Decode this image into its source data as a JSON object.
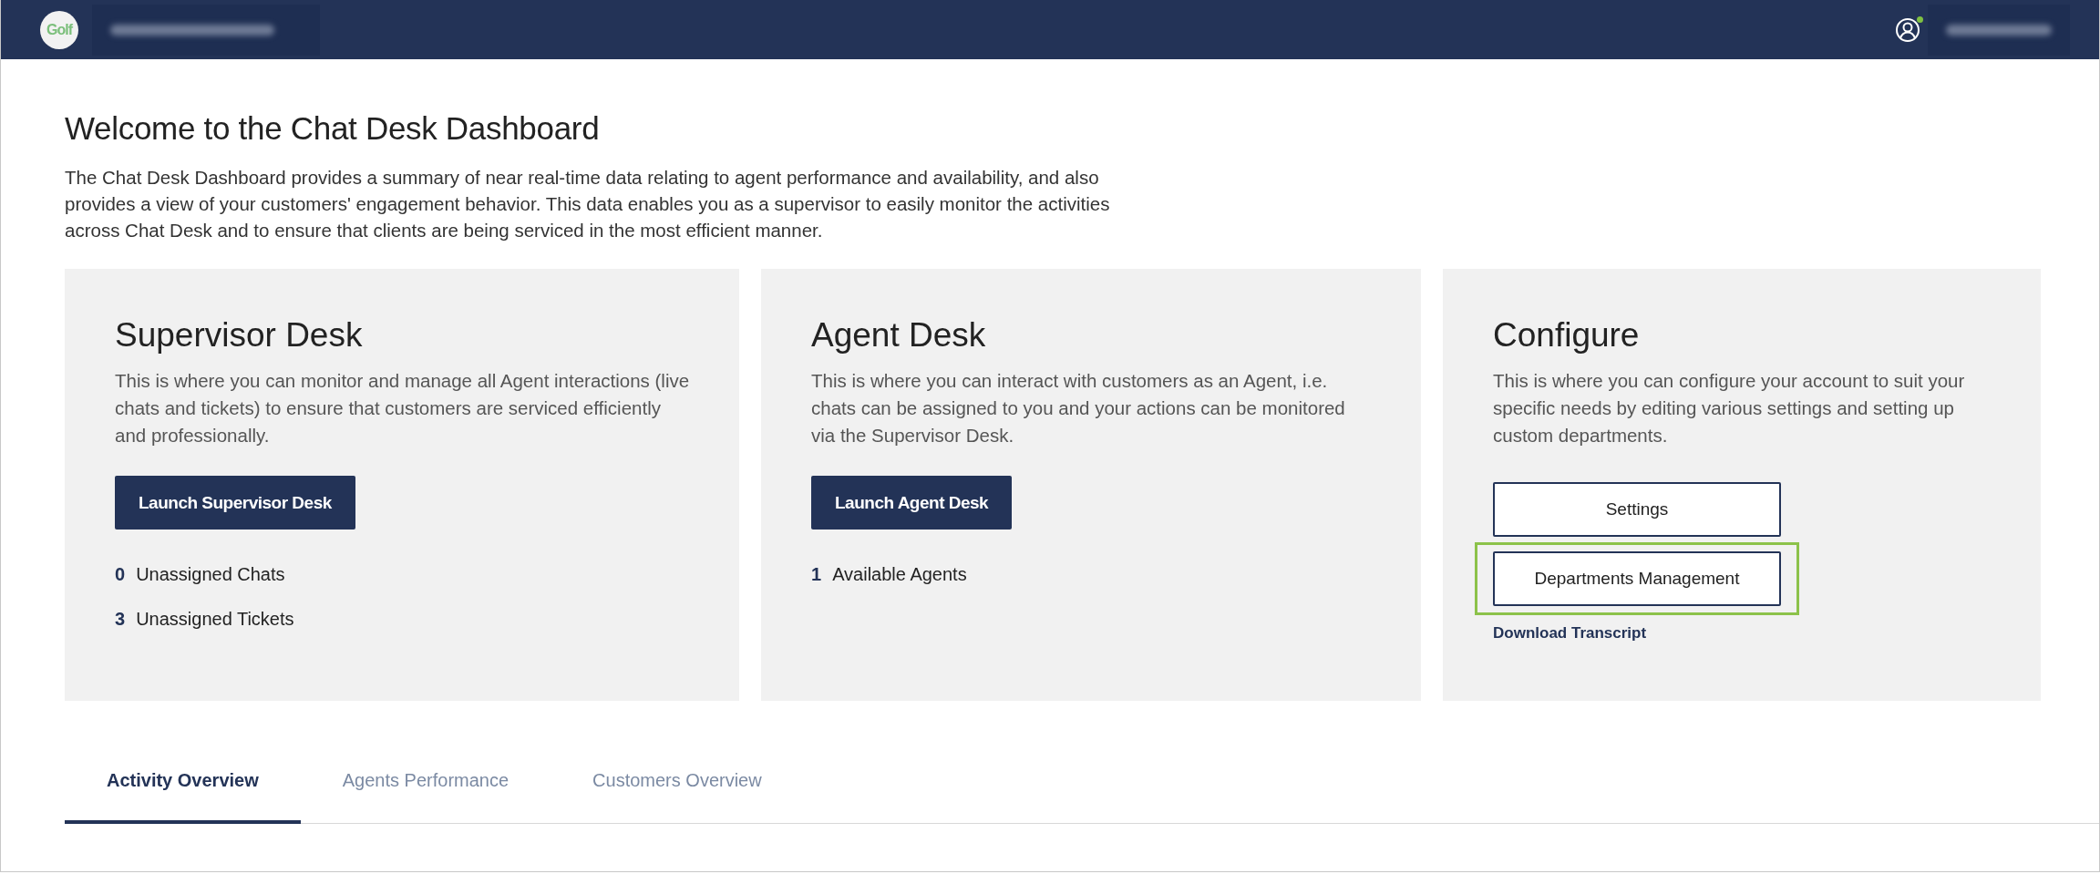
{
  "header": {
    "logo": "Golf",
    "account_name": {
      "kind": "blurred"
    },
    "user": {
      "online": true,
      "name": {
        "kind": "blurred"
      }
    }
  },
  "page": {
    "title": "Welcome to the Chat Desk Dashboard",
    "description": "The Chat Desk Dashboard provides a summary of near real-time data relating to agent performance and availability, and also provides a view of your customers' engagement behavior. This data enables you as a supervisor to easily monitor the activities across Chat Desk and to ensure that clients are being serviced in the most efficient manner."
  },
  "cards": [
    {
      "title": "Supervisor Desk",
      "text": "This is where you can monitor and manage all Agent interactions (live chats and tickets) to ensure that customers are serviced efficiently and professionally.",
      "actions": [
        {
          "kind": "primary",
          "label": "Launch Supervisor Desk",
          "highlighted": false
        }
      ],
      "stats": [
        {
          "count": "0",
          "label": "Unassigned Chats"
        },
        {
          "count": "3",
          "label": "Unassigned Tickets"
        }
      ]
    },
    {
      "title": "Agent Desk",
      "text": "This is where you can interact with customers as an Agent, i.e. chats can be assigned to you and your actions can be monitored via the Supervisor Desk.",
      "actions": [
        {
          "kind": "primary",
          "label": "Launch Agent Desk",
          "highlighted": false
        }
      ],
      "stats": [
        {
          "count": "1",
          "label": "Available Agents"
        }
      ]
    },
    {
      "title": "Configure",
      "text": "This is where you can configure your account to suit your specific needs by editing various settings and setting up custom departments.",
      "actions": [
        {
          "kind": "outline",
          "label": "Settings",
          "highlighted": false
        },
        {
          "kind": "outline",
          "label": "Departments Management",
          "highlighted": true
        },
        {
          "kind": "link",
          "label": "Download Transcript",
          "highlighted": false
        }
      ]
    }
  ],
  "tabs": [
    {
      "label": "Activity Overview",
      "selected": true
    },
    {
      "label": "Agents Performance",
      "selected": false
    },
    {
      "label": "Customers Overview",
      "selected": false
    }
  ]
}
